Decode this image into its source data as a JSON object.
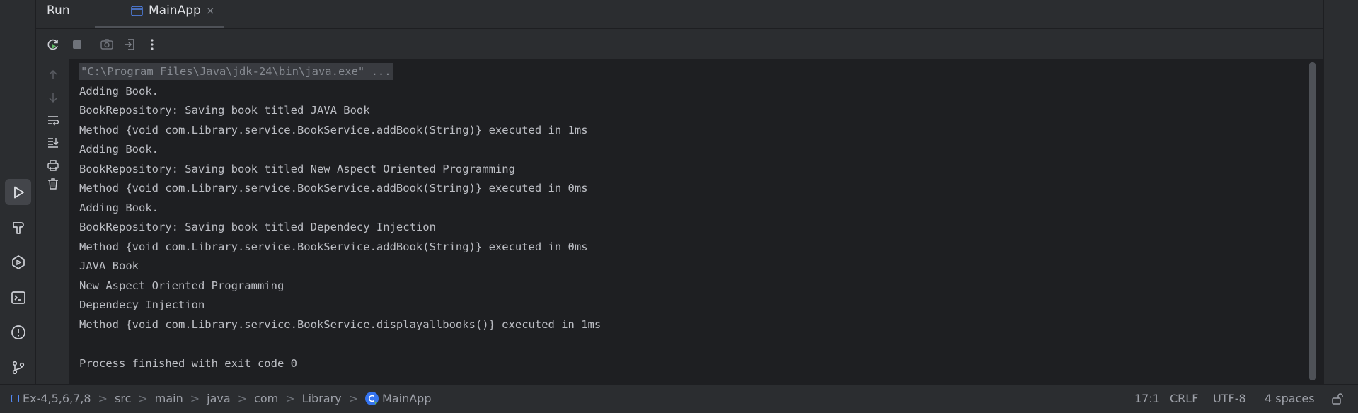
{
  "tabbar": {
    "title": "Run",
    "tab_label": "MainApp",
    "tab_close": "×"
  },
  "left_strip": {
    "icons": [
      "run-icon",
      "build-icon",
      "services-icon",
      "terminal-icon",
      "problems-icon",
      "git-icon"
    ]
  },
  "toolbar": {
    "icons": [
      "rerun-icon",
      "stop-icon",
      "screenshot-icon",
      "restore-layout-icon",
      "more-icon"
    ]
  },
  "side_actions": {
    "icons": [
      "scroll-up-icon",
      "scroll-down-icon",
      "soft-wrap-icon",
      "scroll-to-end-icon",
      "print-icon",
      "clear-icon"
    ]
  },
  "console": {
    "lines": [
      "\"C:\\Program Files\\Java\\jdk-24\\bin\\java.exe\" ...",
      "Adding Book.",
      "BookRepository: Saving book titled JAVA Book",
      "Method {void com.Library.service.BookService.addBook(String)} executed in 1ms",
      "Adding Book.",
      "BookRepository: Saving book titled New Aspect Oriented Programming",
      "Method {void com.Library.service.BookService.addBook(String)} executed in 0ms",
      "Adding Book.",
      "BookRepository: Saving book titled Dependecy Injection",
      "Method {void com.Library.service.BookService.addBook(String)} executed in 0ms",
      "JAVA Book",
      "New Aspect Oriented Programming",
      "Dependecy Injection",
      "Method {void com.Library.service.BookService.displayallbooks()} executed in 1ms",
      "",
      "Process finished with exit code 0"
    ]
  },
  "statusbar": {
    "breadcrumbs": [
      "Ex-4,5,6,7,8",
      "src",
      "main",
      "java",
      "com",
      "Library",
      "MainApp"
    ],
    "separator": ">",
    "position": "17:1",
    "line_ending": "CRLF",
    "encoding": "UTF-8",
    "indent": "4 spaces"
  },
  "colors": {
    "background": "#1e1f22",
    "panel": "#2b2d30",
    "accent": "#3574f0",
    "rerun_green": "#5fb865"
  }
}
